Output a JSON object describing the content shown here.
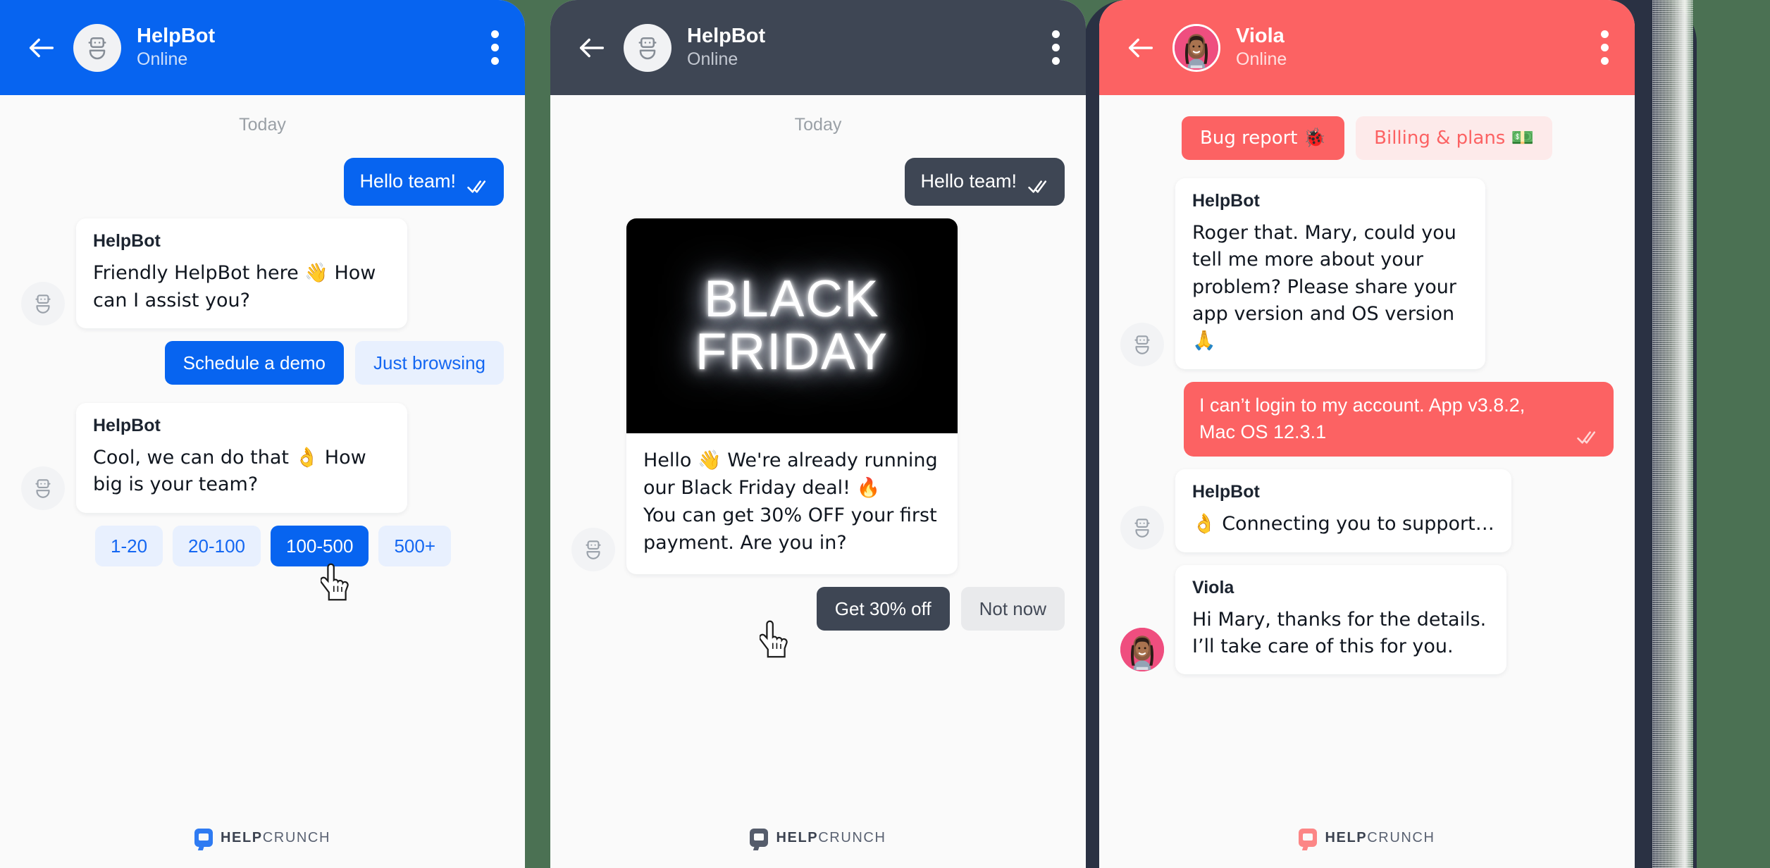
{
  "background_color": "#4b7153",
  "brand": {
    "footer_bold": "HELP",
    "footer_light": "CRUNCH",
    "colors": {
      "blue": "#0764f0",
      "dark": "#3e4654",
      "red": "#fc6263"
    }
  },
  "panels": [
    {
      "id": "blue-bot-chat",
      "theme": "blue",
      "header": {
        "name": "HelpBot",
        "status": "Online",
        "avatar": "bot-icon",
        "back": "back-arrow-icon",
        "menu": "kebab-menu-icon"
      },
      "day_label": "Today",
      "messages": [
        {
          "type": "outgoing",
          "text": "Hello team!",
          "ticks": "double-check-icon"
        },
        {
          "type": "incoming",
          "who": "HelpBot",
          "text": "Friendly HelpBot here 👋 How can I assist you?"
        }
      ],
      "quick_replies_1": [
        {
          "label": "Schedule a demo",
          "style": "solid"
        },
        {
          "label": "Just browsing",
          "style": "ghost"
        }
      ],
      "message_2": {
        "who": "HelpBot",
        "text": "Cool, we can do that 👌 How big is your team?"
      },
      "quick_replies_2": [
        {
          "label": "1-20",
          "style": "ghost"
        },
        {
          "label": "20-100",
          "style": "ghost"
        },
        {
          "label": "100-500",
          "style": "solid"
        },
        {
          "label": "500+",
          "style": "ghost"
        }
      ],
      "cursor_over": "100-500"
    },
    {
      "id": "dark-bot-chat",
      "theme": "dark",
      "header": {
        "name": "HelpBot",
        "status": "Online",
        "avatar": "bot-icon",
        "back": "back-arrow-icon",
        "menu": "kebab-menu-icon"
      },
      "day_label": "Today",
      "messages": [
        {
          "type": "outgoing",
          "text": "Hello team!",
          "ticks": "double-check-icon"
        }
      ],
      "card": {
        "banner_line1": "BLACK",
        "banner_line2": "FRIDAY",
        "text": "Hello 👋 We're already running our Black Friday deal! 🔥\nYou can get 30% OFF your first payment. Are you in?"
      },
      "quick_replies": [
        {
          "label": "Get 30% off",
          "style": "solid"
        },
        {
          "label": "Not now",
          "style": "ghost"
        }
      ],
      "cursor_over": "Get 30% off"
    },
    {
      "id": "red-agent-chat",
      "theme": "red",
      "header": {
        "name": "Viola",
        "status": "Online",
        "avatar": "agent-photo",
        "back": "back-arrow-icon",
        "menu": "kebab-menu-icon"
      },
      "quick_replies_top": [
        {
          "label": "Bug report 🐞",
          "style": "solid"
        },
        {
          "label": "Billing & plans 💵",
          "style": "ghost"
        }
      ],
      "messages": [
        {
          "type": "incoming",
          "who": "HelpBot",
          "avatar": "bot-icon",
          "text": "Roger that. Mary, could you tell me more about your problem? Please share your app version and OS version 🙏"
        },
        {
          "type": "outgoing",
          "text": "I can’t login to my account. App v3.8.2, Mac OS 12.3.1",
          "ticks": "double-check-icon"
        },
        {
          "type": "incoming",
          "who": "HelpBot",
          "avatar": "bot-icon",
          "text": "👌 Connecting you to support…"
        },
        {
          "type": "incoming",
          "who": "Viola",
          "avatar": "agent-photo",
          "text": "Hi Mary, thanks for the details. I’ll take care of this for you."
        }
      ]
    }
  ]
}
